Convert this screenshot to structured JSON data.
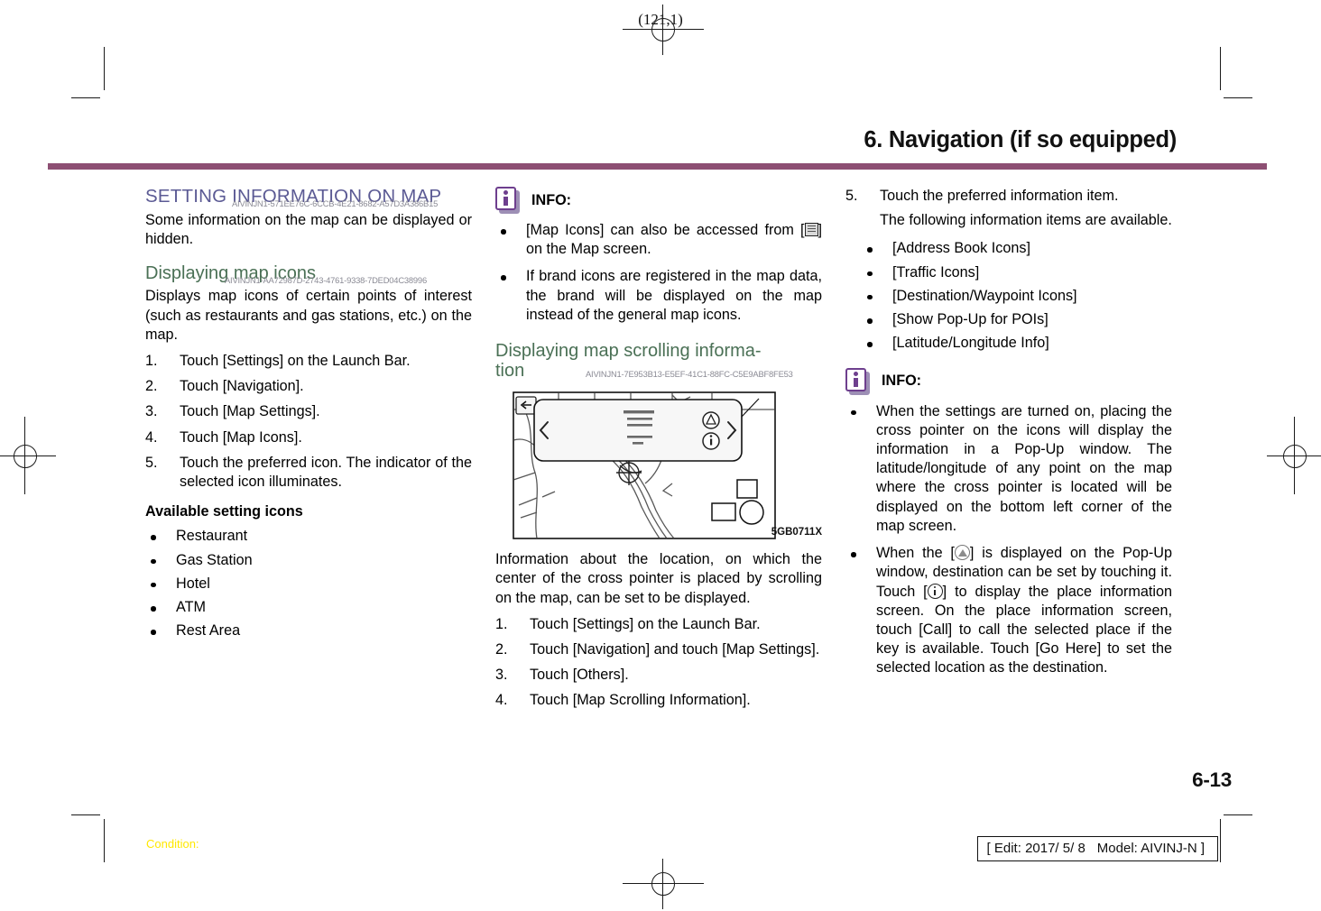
{
  "page": {
    "top_marker": "(121,1)",
    "chapter_title": "6. Navigation (if so equipped)",
    "page_number": "6-13",
    "condition_label": "Condition:",
    "edit_line": {
      "edit": "[ Edit: 2017/ 5/ 8",
      "model": "Model:  AIVINJ-N ]"
    },
    "rule_color": "#8d4f73",
    "heading_color": "#5b5a94",
    "subheading_color": "#4a7055",
    "docid_color": "#8a8a94",
    "condition_color": "#ffe800"
  },
  "col1": {
    "section_title": "SETTING INFORMATION ON MAP",
    "section_docid": "AIVINJN1-571EE76C-6CCB-4E21-8682-A57D3A386B15",
    "intro": "Some information on the map can be displayed or hidden.",
    "sub_title": "Displaying map icons",
    "sub_docid": "AIVINJN1-AA72987D-2743-4761-9338-7DED04C38996",
    "sub_intro": "Displays map icons of certain points of interest (such as restaurants and gas stations, etc.) on the map.",
    "steps": [
      {
        "num": "1.",
        "text": "Touch [Settings] on the Launch Bar."
      },
      {
        "num": "2.",
        "text": "Touch [Navigation]."
      },
      {
        "num": "3.",
        "text": "Touch [Map Settings]."
      },
      {
        "num": "4.",
        "text": "Touch [Map Icons]."
      },
      {
        "num": "5.",
        "text": "Touch the preferred icon. The indicator of the selected icon illuminates."
      }
    ],
    "available_heading": "Available setting icons",
    "available_icons": [
      "Restaurant",
      "Gas Station",
      "Hotel",
      "ATM",
      "Rest Area"
    ]
  },
  "col2": {
    "info_label": "INFO:",
    "info_bullet_1_pre": "[Map Icons] can also be accessed from [",
    "info_bullet_1_post": "] on the Map screen.",
    "info_bullet_1_icon": "map-list-icon",
    "info_bullet_2": "If brand icons are registered in the map data, the brand will be displayed on the map instead of the general map icons.",
    "sub_title": "Displaying map scrolling information",
    "sub_title_line1": "Displaying map scrolling informa-",
    "sub_title_line2": "tion",
    "sub_docid": "AIVINJN1-7E953B13-E5EF-41C1-88FC-C5E9ABF8FE53",
    "figure_id": "5GB0711X",
    "figure_alt": "map screen with pop-up information window, left and right chevrons, destination and info circular buttons",
    "body": "Information about the location, on which the center of the cross pointer is placed by scrolling on the map, can be set to be displayed.",
    "steps": [
      {
        "num": "1.",
        "text": "Touch [Settings] on the Launch Bar."
      },
      {
        "num": "2.",
        "text": "Touch [Navigation] and touch [Map Settings]."
      },
      {
        "num": "3.",
        "text": "Touch [Others]."
      },
      {
        "num": "4.",
        "text": "Touch [Map Scrolling Information]."
      }
    ]
  },
  "col3": {
    "step5_num": "5.",
    "step5_text": "Touch the preferred information item.",
    "step5_sub": "The following information items are available.",
    "items": [
      "[Address Book Icons]",
      "[Traffic Icons]",
      "[Destination/Waypoint Icons]",
      "[Show Pop-Up for POIs]",
      "[Latitude/Longitude Info]"
    ],
    "info_label": "INFO:",
    "info_bullet_1": "When the settings are turned on, placing the cross pointer on the icons will display the information in a Pop-Up window. The latitude/longitude of any point on the map where the cross pointer is located will be displayed on the bottom left corner of the map screen.",
    "info_bullet_2_a": "When the [",
    "info_bullet_2_b": "] is displayed on the Pop-Up window, destination can be set by touching it. Touch [",
    "info_bullet_2_c": "] to display the place information screen.",
    "info_bullet_2_icon_1": "destination-circle-icon",
    "info_bullet_2_icon_2": "info-circle-icon",
    "info_para_2": "On the place information screen, touch [Call] to call the selected place if the key is available.",
    "info_para_3": "Touch [Go Here] to set the selected location as the destination."
  }
}
